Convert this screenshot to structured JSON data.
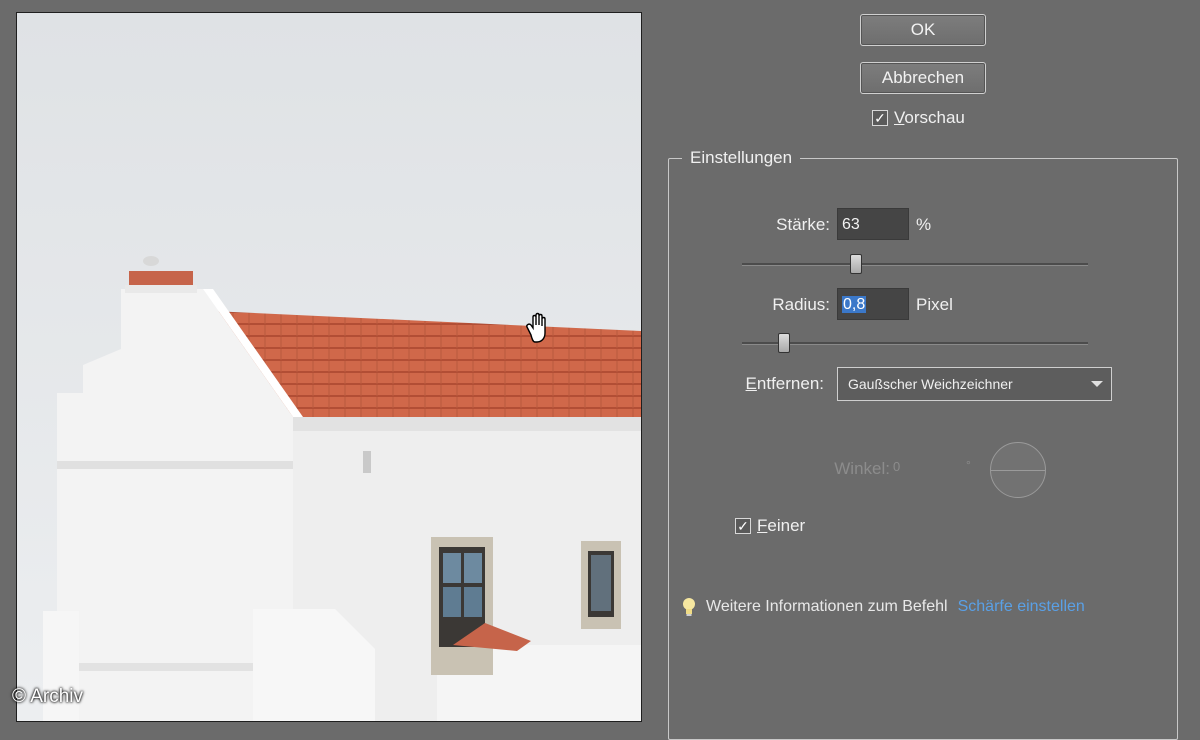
{
  "preview": {
    "copyright": "© Archiv"
  },
  "buttons": {
    "ok_label": "OK",
    "cancel_label": "Abbrechen"
  },
  "preview_toggle": {
    "label": "Vorschau",
    "checked": true
  },
  "settings": {
    "legend": "Einstellungen",
    "amount": {
      "label": "Stärke:",
      "value": "63",
      "unit": "%",
      "slider_level": 0.33
    },
    "radius": {
      "label": "Radius:",
      "value": "0,8",
      "unit": "Pixel",
      "slider_level": 0.12
    },
    "remove": {
      "label": "Entfernen:",
      "selected": "Gaußscher Weichzeichner"
    },
    "angle": {
      "label": "Winkel:",
      "value": "0",
      "symbol": "°"
    },
    "finer": {
      "label": "Feiner",
      "checked": true
    }
  },
  "info": {
    "text": "Weitere Informationen zum Befehl",
    "link": "Schärfe einstellen"
  },
  "icons": [
    "hand-cursor-icon",
    "checkmark-icon",
    "dropdown-arrow-icon",
    "lightbulb-icon",
    "angle-dial-icon"
  ]
}
